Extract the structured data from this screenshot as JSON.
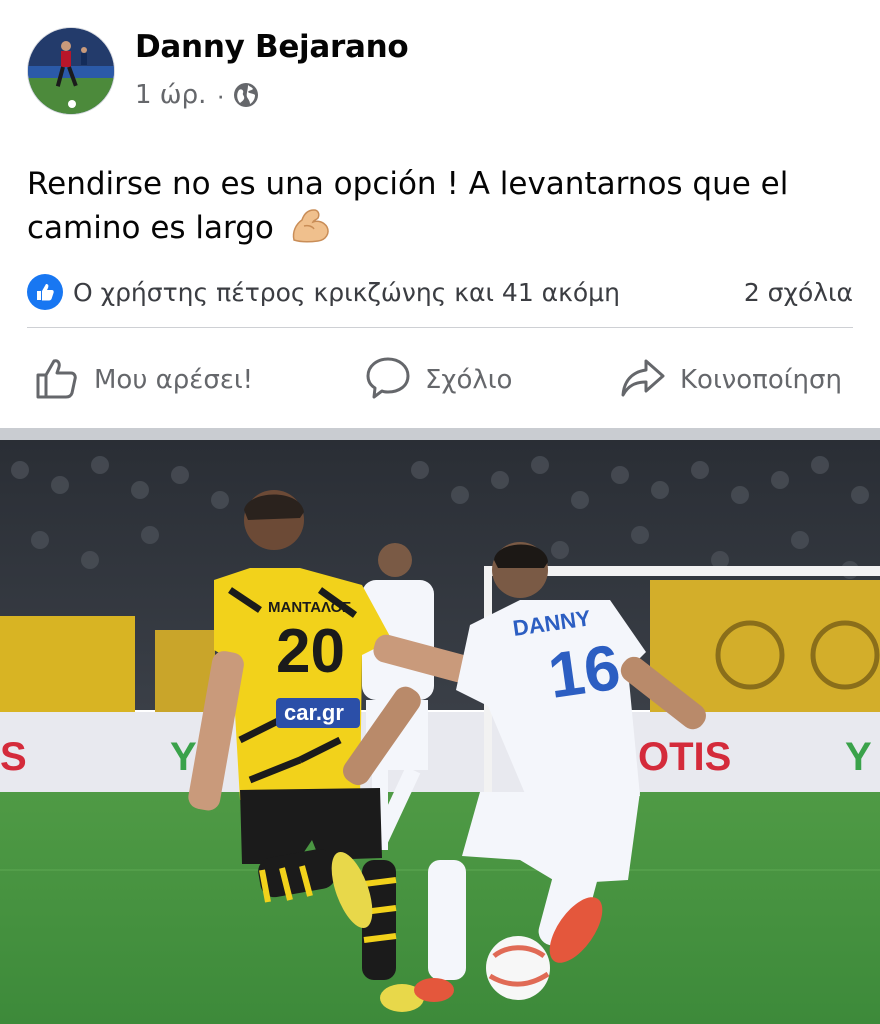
{
  "post": {
    "author": "Danny Bejarano",
    "time": "1 ώρ.",
    "separator": "·",
    "privacy_icon": "globe-icon",
    "text": "Rendirse no es una opción ! A levantarnos que el camino es largo",
    "emoji": "flexed-biceps"
  },
  "reactions": {
    "icon": "like-badge-icon",
    "summary": "Ο χρήστης πέτρος κρικζώνης και 41 ακόμη",
    "comments": "2 σχόλια"
  },
  "actions": {
    "like_label": "Μου αρέσει!",
    "comment_label": "Σχόλιο",
    "share_label": "Κοινοποίηση"
  },
  "photo": {
    "player_yellow_name": "ΜΑΝΤΑΛΟΣ",
    "player_yellow_number": "20",
    "sponsor": "car.gr",
    "player_white_name": "DANNY",
    "player_white_number": "16"
  },
  "colors": {
    "accent": "#1877f2",
    "text_secondary": "#65676b",
    "jersey_yellow": "#f2d21b",
    "jersey_white": "#f4f6fb",
    "pitch": "#3d8a3a"
  }
}
